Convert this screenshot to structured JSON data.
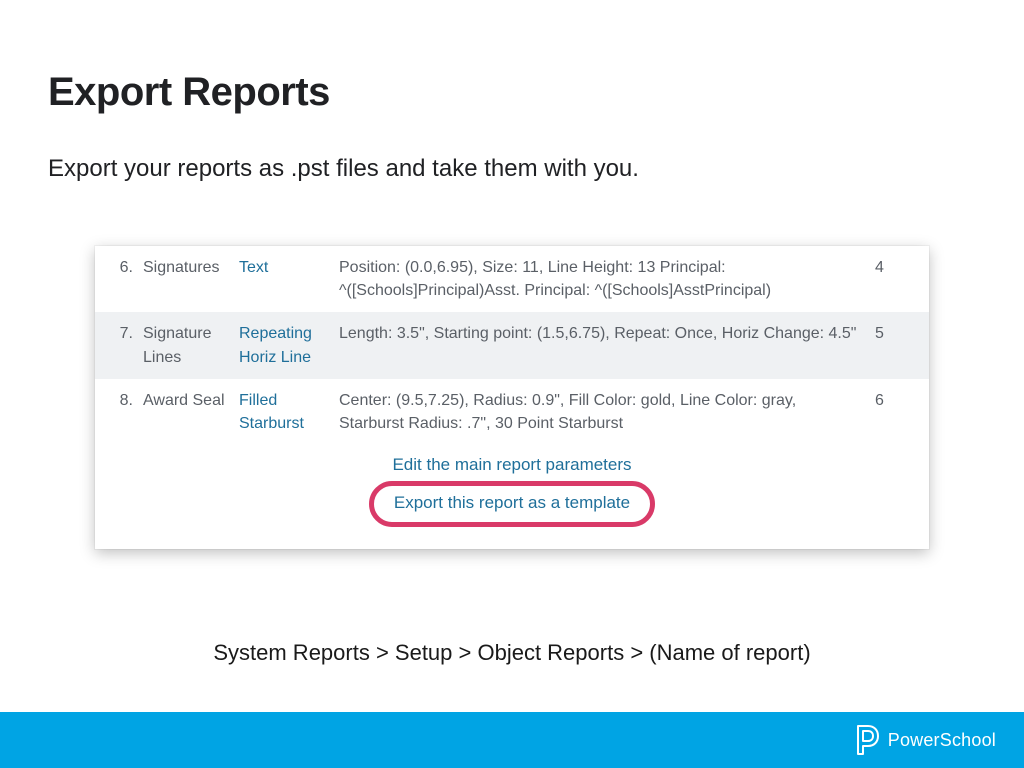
{
  "title": "Export Reports",
  "subtitle": "Export your reports as .pst files and take them with you.",
  "rows": [
    {
      "num": "6.",
      "name": "Signatures",
      "type": "Text",
      "desc": "Position: (0.0,6.95), Size: 11, Line Height: 13 Principal: ^([Schools]Principal)Asst. Principal: ^([Schools]AsstPrincipal)",
      "last": "4"
    },
    {
      "num": "7.",
      "name": "Signature Lines",
      "type": "Repeating Horiz Line",
      "desc": "Length: 3.5\", Starting point: (1.5,6.75), Repeat: Once, Horiz Change: 4.5\"",
      "last": "5"
    },
    {
      "num": "8.",
      "name": "Award Seal",
      "type": "Filled Starburst",
      "desc": "Center: (9.5,7.25), Radius: 0.9\", Fill Color: gold, Line Color: gray, Starburst Radius: .7\", 30 Point Starburst",
      "last": "6"
    }
  ],
  "actions": {
    "edit": "Edit the main report parameters",
    "export": "Export this report as a template"
  },
  "breadcrumb": "System Reports > Setup > Object Reports > (Name of report)",
  "brand": "PowerSchool"
}
